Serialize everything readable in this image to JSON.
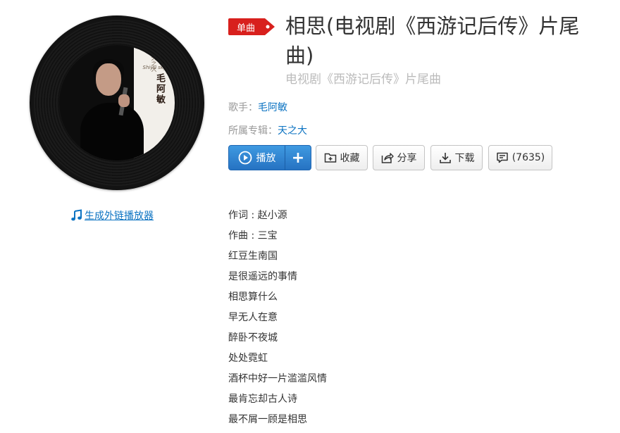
{
  "song": {
    "tag": "单曲",
    "title": "相思(电视剧《西游记后传》片尾曲)",
    "subtitle": "电视剧《西游记后传》片尾曲",
    "artist_label": "歌手：",
    "artist": "毛阿敏",
    "album_label": "所属专辑：",
    "album": "天之大"
  },
  "cover": {
    "calligraphy": "毛阿敏",
    "small_script": "天之大",
    "small_italic": "Shiyu sky"
  },
  "external_player_link": "生成外链播放器",
  "buttons": {
    "play": "播放",
    "add": "+",
    "collect": "收藏",
    "share": "分享",
    "download": "下载",
    "comments": "(7635)"
  },
  "lyrics": [
    "作词 : 赵小源",
    "作曲 : 三宝",
    "红豆生南国",
    "是很遥远的事情",
    "相思算什么",
    "早无人在意",
    "醉卧不夜城",
    "处处霓虹",
    "酒杯中好一片滥滥风情",
    "最肯忘却古人诗",
    "最不屑一顾是相思"
  ],
  "colors": {
    "link": "#0c73c2",
    "tag_red": "#d8201d",
    "play_blue": "#2c7fd0"
  }
}
